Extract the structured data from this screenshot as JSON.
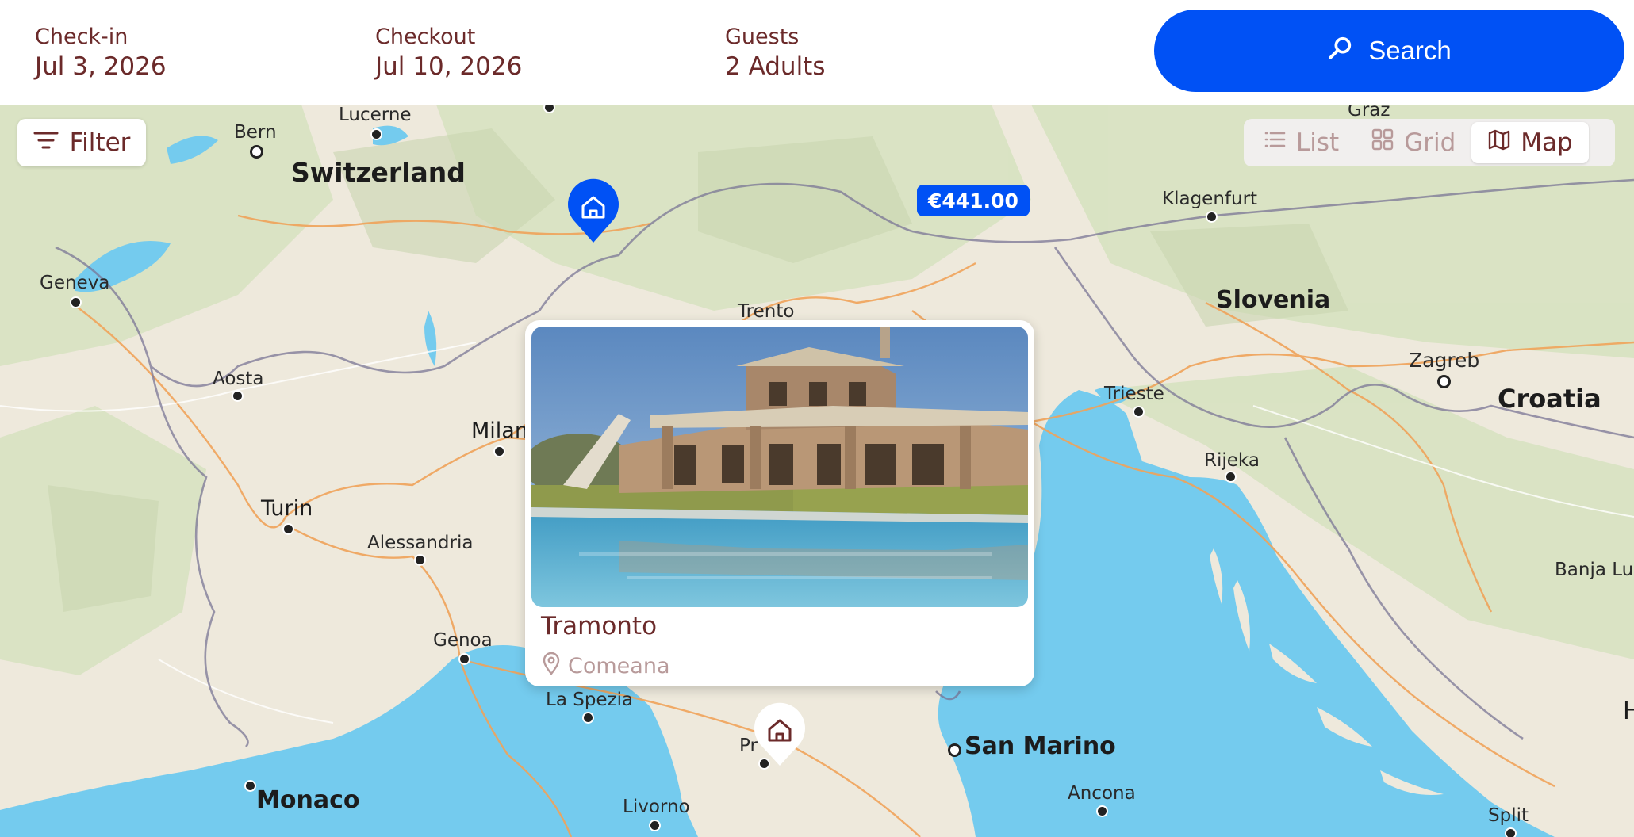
{
  "booking": {
    "checkin_label": "Check-in",
    "checkin_value": "Jul 3, 2026",
    "checkout_label": "Checkout",
    "checkout_value": "Jul 10, 2026",
    "guests_label": "Guests",
    "guests_value": "2 Adults",
    "search_label": "Search",
    "search_icon": "search-icon"
  },
  "toolbar": {
    "filter_label": "Filter",
    "filter_icon": "filter-icon",
    "views": [
      {
        "label": "List",
        "icon": "list-icon",
        "active": false
      },
      {
        "label": "Grid",
        "icon": "grid-icon",
        "active": false
      },
      {
        "label": "Map",
        "icon": "map-icon",
        "active": true
      }
    ]
  },
  "map": {
    "places": {
      "lucerne": "Lucerne",
      "bern": "Bern",
      "switzerland": "Switzerland",
      "geneva": "Geneva",
      "aosta": "Aosta",
      "milan": "Milan",
      "turin": "Turin",
      "alessandria": "Alessandria",
      "genoa": "Genoa",
      "la_spezia": "La Spezia",
      "monaco": "Monaco",
      "livorno": "Livorno",
      "prato": "Pr",
      "trento": "Trento",
      "graz": "Graz",
      "klagenfurt": "Klagenfurt",
      "slovenia": "Slovenia",
      "trieste": "Trieste",
      "rijeka": "Rijeka",
      "zagreb": "Zagreb",
      "croatia": "Croatia",
      "banja_luka": "Banja Lu",
      "san_marino": "San Marino",
      "ancona": "Ancona",
      "split": "Split",
      "edge_h": "H"
    },
    "price_marker": "€441.00",
    "pin_icon": "home-icon"
  },
  "card": {
    "title": "Tramonto",
    "location": "Comeana",
    "location_icon": "location-pin-icon"
  },
  "colors": {
    "brand_blue": "#0051f5",
    "text_maroon": "#6b2a2a",
    "muted_pink": "#b89a9a",
    "sea": "#74cbee",
    "land": "#eee9dc"
  }
}
